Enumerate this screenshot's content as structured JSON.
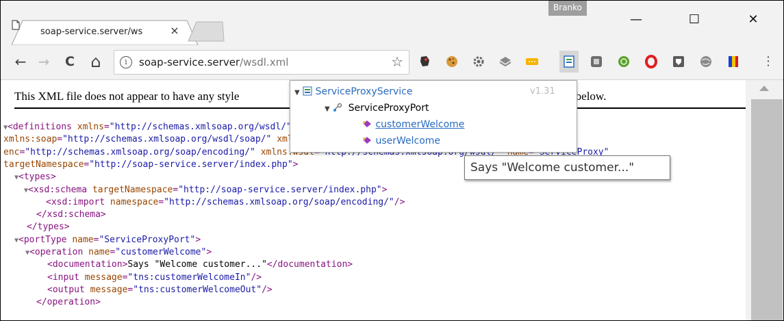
{
  "browser": {
    "tab_title": "soap-service.server/wsdl.xml",
    "tab_close": "×",
    "user_name": "Branko",
    "window_controls": {
      "minimize": "—",
      "maximize": "☐",
      "close": "✕"
    },
    "nav": {
      "back": "←",
      "forward": "→",
      "reload": "C",
      "home": "⌂"
    },
    "url_host": "soap-service.server",
    "url_path": "/wsdl.xml",
    "bookmark_star": "☆",
    "menu_dots": "⋮",
    "extensions": [
      "wappalyzer-icon",
      "cookie-icon",
      "gear-extension-icon",
      "layers-icon",
      "yellow-dots-icon",
      "wsdl-wizard-icon",
      "square-icon",
      "green-circle-icon",
      "opera-icon",
      "shield-icon",
      "globe-icon",
      "color-bars-icon"
    ]
  },
  "page": {
    "notice": "This XML file does not appear to have any style information associated with it. The document tree is shown below.",
    "notice_visible_left": "This XML file does not appear to have any style",
    "notice_visible_right": "is shown below.",
    "xml_lines": [
      {
        "tri": "▼",
        "t": "<definitions xmlns=\"http://schemas.xmlsoap.org/wsdl/\" xmlns:tns=\"http://soap-service.server/index.php\""
      },
      {
        "tri": "",
        "t": "xmlns:soap=\"http://schemas.xmlsoap.org/wsdl/soap/\" xmlns:xsd=\"http://www.w3.org/2001/XMLSchema\" xmlns:soap-"
      },
      {
        "tri": "",
        "t": "enc=\"http://schemas.xmlsoap.org/soap/encoding/\" xmlns:wsdl=\"http://schemas.xmlsoap.org/wsdl/\" name=\"ServiceProxy\""
      },
      {
        "tri": "",
        "t": "targetNamespace=\"http://soap-service.server/index.php\">"
      },
      {
        "tri": "▼",
        "t": "<types>"
      },
      {
        "tri": "▼",
        "t": "<xsd:schema targetNamespace=\"http://soap-service.server/index.php\">"
      },
      {
        "tri": "",
        "t": "<xsd:import namespace=\"http://schemas.xmlsoap.org/soap/encoding/\"/>"
      },
      {
        "tri": "",
        "t": "</xsd:schema>"
      },
      {
        "tri": "",
        "t": "</types>"
      },
      {
        "tri": "▼",
        "t": "<portType name=\"ServiceProxyPort\">"
      },
      {
        "tri": "▼",
        "t": "<operation name=\"customerWelcome\">"
      },
      {
        "tri": "",
        "t": "<documentation>Says \"Welcome customer...\"</documentation>"
      },
      {
        "tri": "",
        "t": "<input message=\"tns:customerWelcomeIn\"/>"
      },
      {
        "tri": "",
        "t": "<output message=\"tns:customerWelcomeOut\"/>"
      },
      {
        "tri": "",
        "t": "</operation>"
      }
    ]
  },
  "popup": {
    "service": "ServiceProxyService",
    "version": "v1.31",
    "port": "ServiceProxyPort",
    "operations": [
      "customerWelcome",
      "userWelcome"
    ]
  },
  "tooltip": "Says \"Welcome customer...\""
}
